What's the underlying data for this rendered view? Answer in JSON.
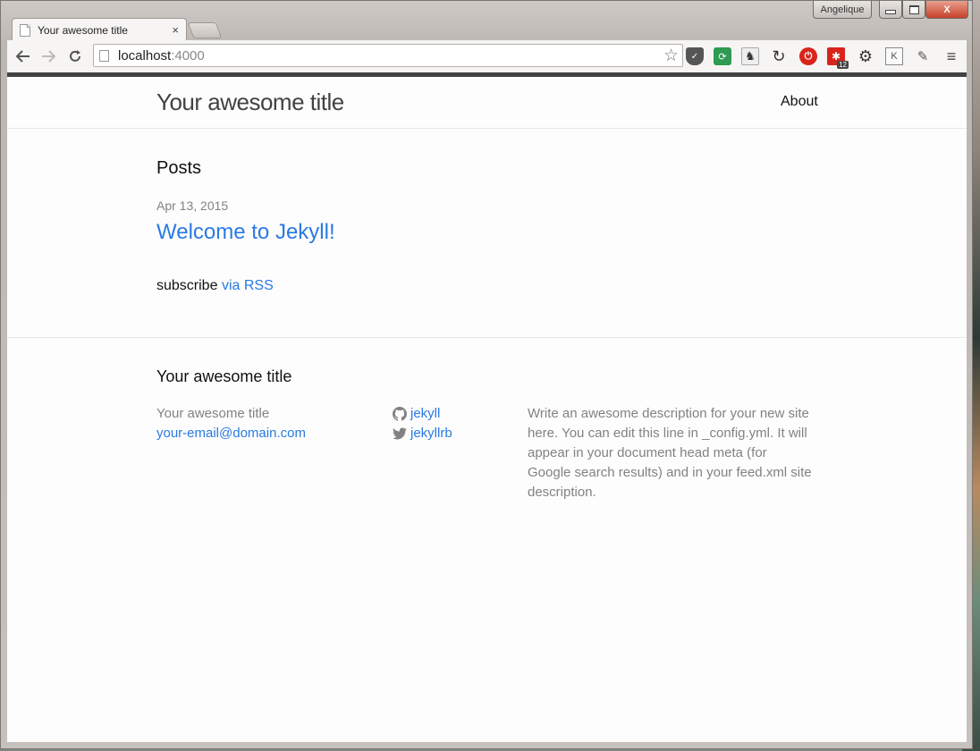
{
  "window": {
    "profile_label": "Angelique",
    "tab_title": "Your awesome title",
    "close_glyph": "×",
    "close_window_glyph": "X"
  },
  "toolbar": {
    "url_host": "localhost",
    "url_port": ":4000"
  },
  "page": {
    "site_title": "Your awesome title",
    "nav_about": "About",
    "posts_heading": "Posts",
    "post": {
      "date": "Apr 13, 2015",
      "title": "Welcome to Jekyll!"
    },
    "rss_prefix": "subscribe",
    "rss_link": "via RSS"
  },
  "footer": {
    "heading": "Your awesome title",
    "name": "Your awesome title",
    "email": "your-email@domain.com",
    "github_handle": "jekyll",
    "twitter_handle": "jekyllrb",
    "description": "Write an awesome description for your new site here. You can edit this line in _config.yml. It will appear in your document head meta (for Google search results) and in your feed.xml site description."
  },
  "colors": {
    "link": "#2a7ae2",
    "text": "#111111",
    "muted": "#828282",
    "header_bar": "#424242"
  }
}
